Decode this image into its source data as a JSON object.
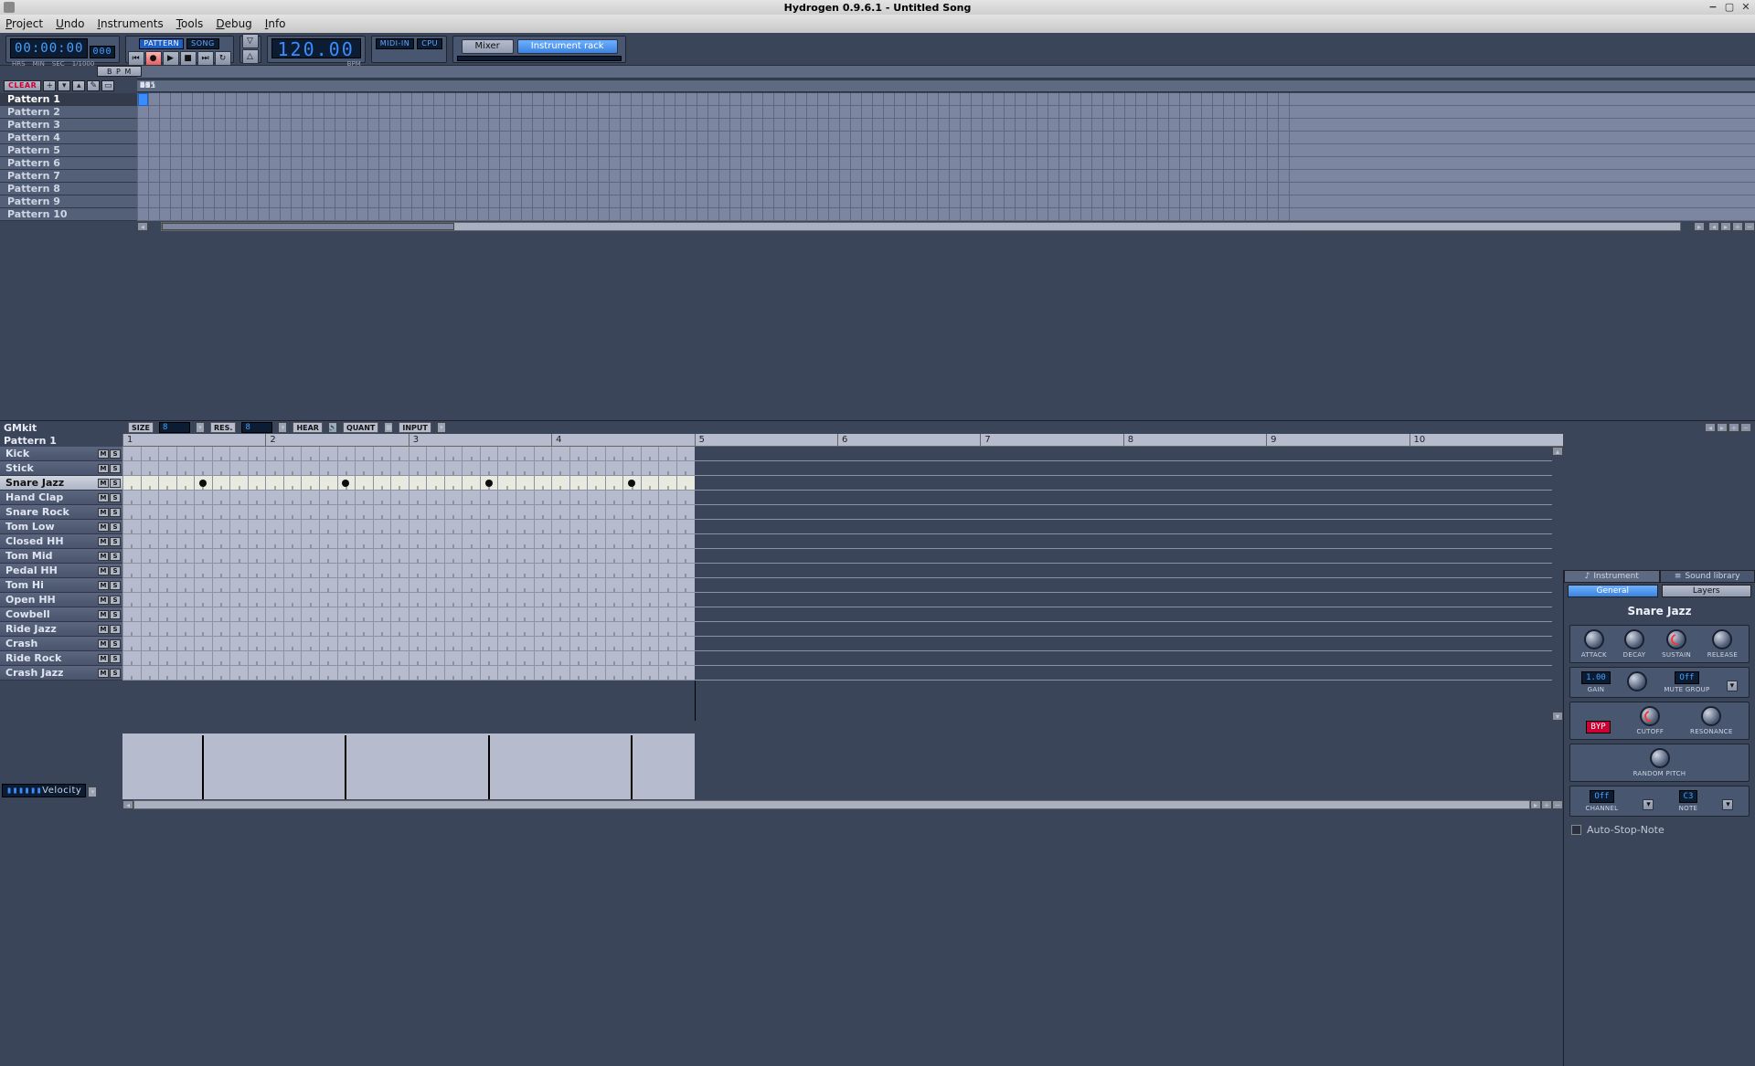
{
  "window": {
    "title": "Hydrogen 0.9.6.1 - Untitled Song"
  },
  "menu": {
    "items": [
      "Project",
      "Undo",
      "Instruments",
      "Tools",
      "Debug",
      "Info"
    ]
  },
  "transport": {
    "time": "00:00:00",
    "time_ms": "000",
    "hrs": "HRS",
    "min": "MIN",
    "sec": "SEC",
    "ms": "1/1000",
    "mode_pattern": "PATTERN",
    "mode_song": "SONG",
    "bpm": "120.00",
    "bpm_label": "BPM",
    "midi_in": "MIDI-IN",
    "cpu": "CPU",
    "mixer": "Mixer",
    "rack": "Instrument rack"
  },
  "songed": {
    "bpm_chip": "B P M",
    "clear": "CLEAR",
    "patterns": [
      "Pattern 1",
      "Pattern 2",
      "Pattern 3",
      "Pattern 4",
      "Pattern 5",
      "Pattern 6",
      "Pattern 7",
      "Pattern 8",
      "Pattern 9",
      "Pattern 10"
    ],
    "selected_pattern": 0,
    "ruler_step": 4,
    "ruler_count": 106,
    "active_cell": {
      "row": 0,
      "col": 0
    }
  },
  "patterned": {
    "kit": "GMkit",
    "pattern_name": "Pattern 1",
    "size_label": "SIZE",
    "size_val": "8",
    "res_label": "RES.",
    "res_val": "8",
    "hear": "HEAR",
    "quant": "QUANT",
    "input": "INPUT",
    "beats": 10,
    "active_beats": 4,
    "subdiv": 8,
    "instruments": [
      "Kick",
      "Stick",
      "Snare Jazz",
      "Hand Clap",
      "Snare Rock",
      "Tom Low",
      "Closed HH",
      "Tom Mid",
      "Pedal HH",
      "Tom Hi",
      "Open HH",
      "Cowbell",
      "Ride Jazz",
      "Crash",
      "Ride Rock",
      "Crash Jazz"
    ],
    "selected_instrument": 2,
    "notes": [
      {
        "inst": 2,
        "pos": 4
      },
      {
        "inst": 2,
        "pos": 12
      },
      {
        "inst": 2,
        "pos": 20
      },
      {
        "inst": 2,
        "pos": 28
      }
    ],
    "velocity_label": "Velocity"
  },
  "rack": {
    "tab_instrument": "Instrument",
    "tab_library": "Sound library",
    "sub_general": "General",
    "sub_layers": "Layers",
    "instrument_name": "Snare Jazz",
    "adsr": [
      "ATTACK",
      "DECAY",
      "SUSTAIN",
      "RELEASE"
    ],
    "gain_lbl": "GAIN",
    "gain_val": "1.00",
    "mute_lbl": "MUTE GROUP",
    "mute_val": "Off",
    "filter_byp": "BYP",
    "cutoff": "CUTOFF",
    "resonance": "RESONANCE",
    "random_pitch": "RANDOM PITCH",
    "channel_lbl": "CHANNEL",
    "channel_val": "Off",
    "note_lbl": "NOTE",
    "note_val": "C3",
    "autostop": "Auto-Stop-Note"
  }
}
